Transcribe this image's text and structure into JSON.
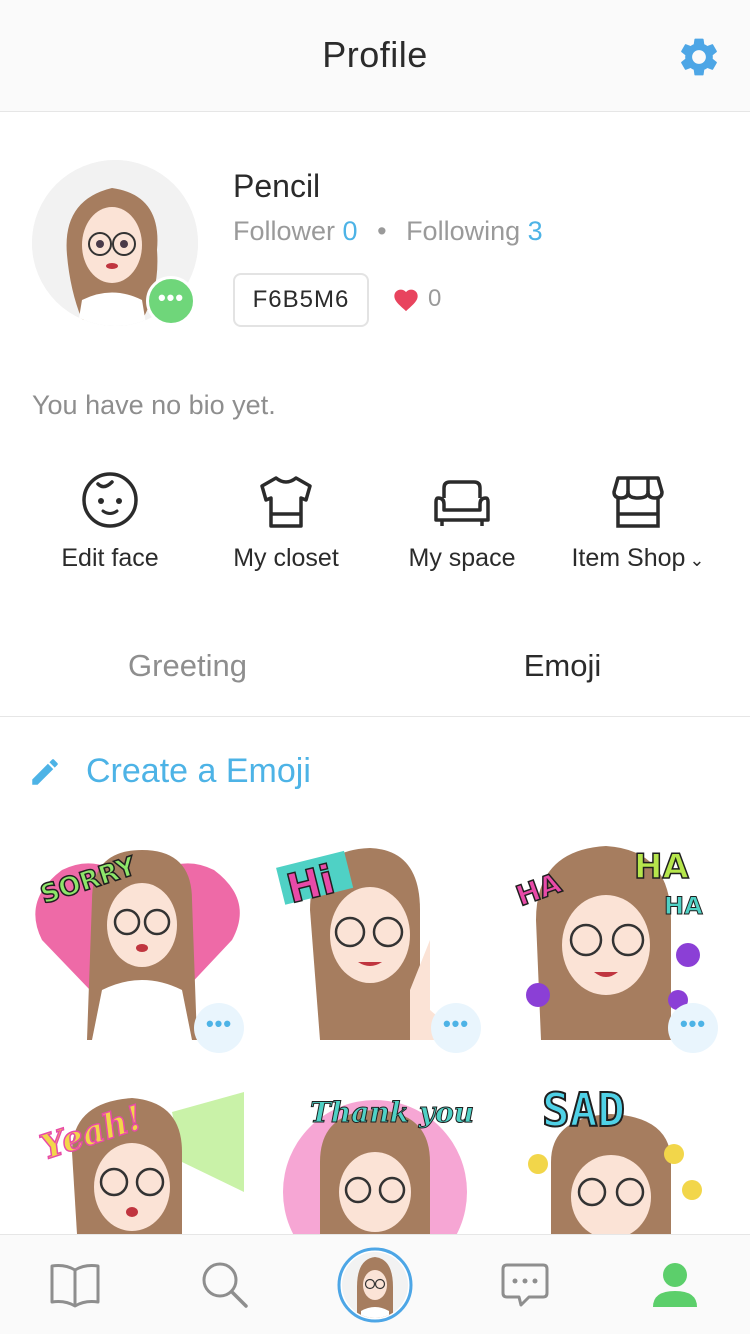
{
  "header": {
    "title": "Profile",
    "settings_icon": "gear-icon"
  },
  "profile": {
    "name": "Pencil",
    "follower_label": "Follower",
    "follower_count": "0",
    "following_label": "Following",
    "following_count": "3",
    "code": "F6B5M6",
    "likes": "0",
    "bio": "You have no bio yet.",
    "badge_text": "•••"
  },
  "actions": [
    {
      "label": "Edit face",
      "icon": "face-icon"
    },
    {
      "label": "My closet",
      "icon": "shirt-icon"
    },
    {
      "label": "My space",
      "icon": "sofa-icon"
    },
    {
      "label": "Item Shop",
      "icon": "shop-icon"
    }
  ],
  "tabs": {
    "greeting": "Greeting",
    "emoji": "Emoji",
    "active": "Emoji"
  },
  "create": {
    "label": "Create a Emoji"
  },
  "stickers": [
    {
      "caption": "SORRY"
    },
    {
      "caption": "Hi"
    },
    {
      "caption": "HA"
    },
    {
      "caption": "Yeah!"
    },
    {
      "caption": "Thank you"
    },
    {
      "caption": "SAD"
    }
  ],
  "sticker_more": "•••",
  "nav": [
    {
      "name": "book",
      "icon": "book-icon"
    },
    {
      "name": "search",
      "icon": "search-icon"
    },
    {
      "name": "avatar",
      "icon": "avatar-icon"
    },
    {
      "name": "chat",
      "icon": "chat-icon"
    },
    {
      "name": "profile",
      "icon": "person-icon",
      "active": true
    }
  ],
  "colors": {
    "accent": "#4db3e6",
    "online": "#6fd67a",
    "heart": "#e8445e",
    "active_nav": "#5ccf6b"
  }
}
